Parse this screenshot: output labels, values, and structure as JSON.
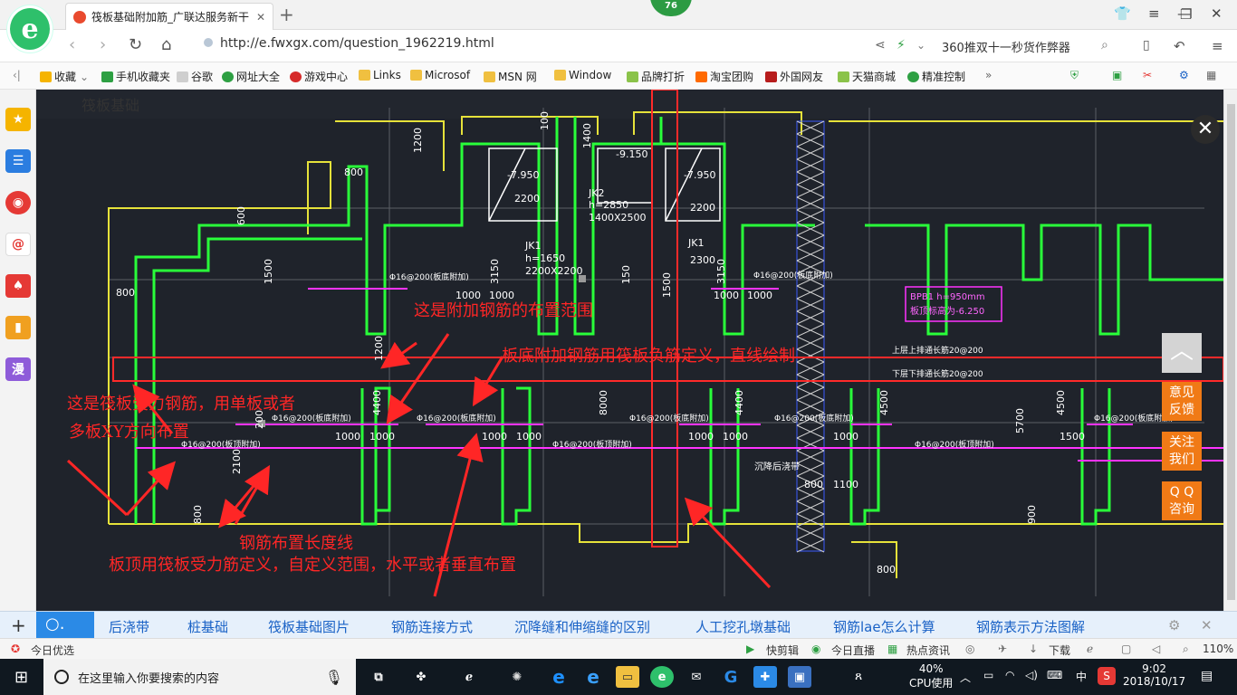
{
  "browser": {
    "tab_title": "筏板基础附加筋_广联达服务新干",
    "badge": "76",
    "url": "http://e.fwxgx.com/question_1962219.html",
    "search_text": "360推双十一秒货作弊器"
  },
  "bookmarks": [
    {
      "label": "收藏",
      "color": "#f5b400"
    },
    {
      "label": "手机收藏夹",
      "color": "#2ea043"
    },
    {
      "label": "谷歌",
      "color": "#bbbbbb"
    },
    {
      "label": "网址大全",
      "color": "#2ea043"
    },
    {
      "label": "游戏中心",
      "color": "#d62b2b"
    },
    {
      "label": "Links",
      "color": "#f0c040"
    },
    {
      "label": "Microsof",
      "color": "#f0c040"
    },
    {
      "label": "MSN 网",
      "color": "#f0c040"
    },
    {
      "label": "Window",
      "color": "#f0c040"
    },
    {
      "label": "品牌打折",
      "color": "#8bc34a"
    },
    {
      "label": "淘宝团购",
      "color": "#ff6a00"
    },
    {
      "label": "外国网友",
      "color": "#b71c1c"
    },
    {
      "label": "天猫商城",
      "color": "#8bc34a"
    },
    {
      "label": "精准控制",
      "color": "#2ea043"
    }
  ],
  "page": {
    "heading": "筏板基础",
    "annotations": [
      "这是附加钢筋的布置范围",
      "板底附加钢筋用筏板负筋定义，直线绘制",
      "这是筏板受力钢筋，用单板或者",
      "多板XY方向布置",
      "钢筋布置长度线",
      "板顶用筏板受力筋定义，自定义范围，水平或者垂直布置"
    ],
    "cad_labels": {
      "dims": [
        "1200",
        "100",
        "1400",
        "800",
        "600",
        "1500",
        "800",
        "1200",
        "200",
        "4400",
        "8000",
        "4400",
        "4500",
        "5700",
        "4500",
        "2100",
        "800",
        "900",
        "800",
        "1100",
        "800",
        "3150",
        "3150",
        "150",
        "1500",
        "1000",
        "1000",
        "1000",
        "1000",
        "1000",
        "1000",
        "1000",
        "1000",
        "1000",
        "1000",
        "1000",
        "1500"
      ],
      "elev1": "-7.950",
      "elev2": "-9.150",
      "elev3": "-7.950",
      "jk2": "JK2",
      "jk2_h": "h=2850",
      "jk2_size": "1400X2500",
      "jk1a": "JK1",
      "jk1a_h": "h=1650",
      "jk1a_size": "2200X2200",
      "jk1b": "JK1",
      "jk1b_size": "2300",
      "pb1": "BPB1 h=950mm",
      "pb1_top": "板顶标高为-6.250",
      "rebar_top": "上层上排通长筋20@200",
      "rebar_bot": "下层下排通长筋20@200",
      "rebar_add": "Φ16@200(板底附加)",
      "rebar_add2": "Φ16@200(板顶附加)",
      "post": "沉降后浇带",
      "two200": "2200",
      "two200b": "2200",
      "two300": "2300"
    }
  },
  "side_buttons": [
    "意见\n反馈",
    "关注\n我们",
    "Q Q\n咨询"
  ],
  "related": [
    "后浇带",
    "桩基础",
    "筏板基础图片",
    "钢筋连接方式",
    "沉降缝和伸缩缝的区别",
    "人工挖孔墩基础",
    "钢筋lae怎么计算",
    "钢筋表示方法图解"
  ],
  "status": {
    "left": "今日优选",
    "items": [
      "快剪辑",
      "今日直播",
      "热点资讯",
      "下载"
    ],
    "zoom": "110%"
  },
  "taskbar": {
    "search_placeholder": "在这里输入你要搜索的内容",
    "cpu": "40%",
    "cpu_label": "CPU使用",
    "ime": "中",
    "time": "9:02",
    "date": "2018/10/17"
  }
}
